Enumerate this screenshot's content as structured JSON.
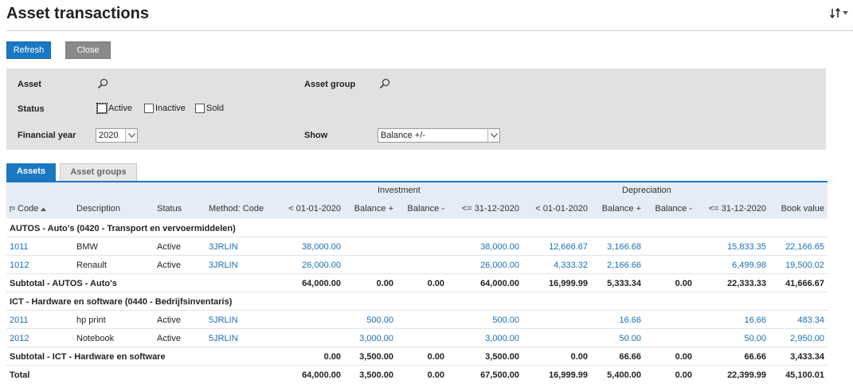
{
  "page": {
    "title": "Asset transactions"
  },
  "toolbar": {
    "refresh_label": "Refresh",
    "close_label": "Close"
  },
  "filters": {
    "asset_label": "Asset",
    "asset_group_label": "Asset group",
    "status_label": "Status",
    "status_options": [
      "Active",
      "Inactive",
      "Sold"
    ],
    "financial_year_label": "Financial year",
    "financial_year_value": "2020",
    "show_label": "Show",
    "show_value": "Balance +/-"
  },
  "tabs": [
    {
      "label": "Assets",
      "active": true
    },
    {
      "label": "Asset groups",
      "active": false
    }
  ],
  "table": {
    "group_headers": {
      "investment": "Investment",
      "depreciation": "Depreciation"
    },
    "columns": [
      "Code",
      "Description",
      "Status",
      "Method: Code",
      "< 01-01-2020",
      "Balance +",
      "Balance -",
      "<= 31-12-2020",
      "< 01-01-2020",
      "Balance +",
      "Balance -",
      "<= 31-12-2020",
      "Book value"
    ],
    "groups": [
      {
        "title": "AUTOS - Auto's (0420 - Transport en vervoermiddelen)",
        "rows": [
          [
            "1011",
            "BMW",
            "Active",
            "3JRLIN",
            "38,000.00",
            "",
            "",
            "38,000.00",
            "12,666.67",
            "3,166.68",
            "",
            "15,833.35",
            "22,166.65"
          ],
          [
            "1012",
            "Renault",
            "Active",
            "3JRLIN",
            "26,000.00",
            "",
            "",
            "26,000.00",
            "4,333.32",
            "2,166.66",
            "",
            "6,499.98",
            "19,500.02"
          ]
        ],
        "subtotal_label": "Subtotal - AUTOS - Auto's",
        "subtotal": [
          "64,000.00",
          "0.00",
          "0.00",
          "64,000.00",
          "16,999.99",
          "5,333.34",
          "0.00",
          "22,333.33",
          "41,666.67"
        ]
      },
      {
        "title": "ICT - Hardware en software (0440 - Bedrijfsinventaris)",
        "rows": [
          [
            "2011",
            "hp print",
            "Active",
            "5JRLIN",
            "",
            "500.00",
            "",
            "500.00",
            "",
            "16.66",
            "",
            "16.66",
            "483.34"
          ],
          [
            "2012",
            "Notebook",
            "Active",
            "5JRLIN",
            "",
            "3,000.00",
            "",
            "3,000.00",
            "",
            "50.00",
            "",
            "50.00",
            "2,950.00"
          ]
        ],
        "subtotal_label": "Subtotal - ICT - Hardware en software",
        "subtotal": [
          "0.00",
          "3,500.00",
          "0.00",
          "3,500.00",
          "0.00",
          "66.66",
          "0.00",
          "66.66",
          "3,433.34"
        ]
      }
    ],
    "total_label": "Total",
    "total": [
      "64,000.00",
      "3,500.00",
      "0.00",
      "67,500.00",
      "16,999.99",
      "5,400.00",
      "0.00",
      "22,399.99",
      "45,100.01"
    ]
  },
  "colors": {
    "primary": "#1a78c2",
    "link": "#1a6fb8",
    "panel": "#e1e1e1",
    "header_band": "#e5ecf5"
  }
}
